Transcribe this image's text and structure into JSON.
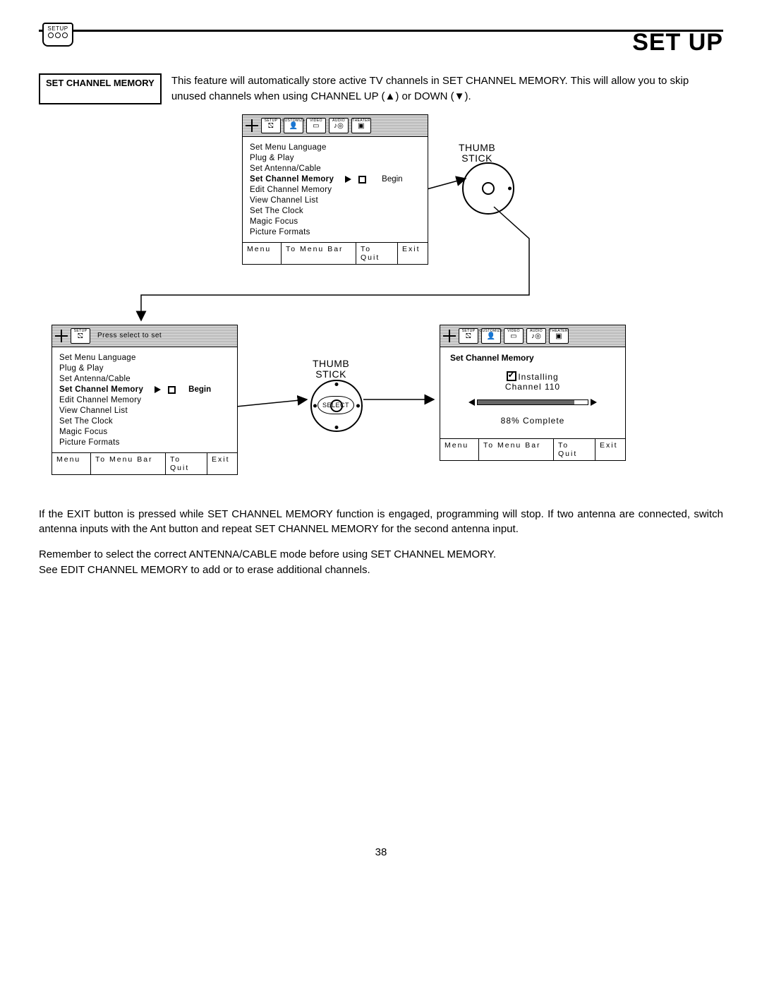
{
  "header": {
    "title": "SET UP",
    "badge_label": "SETUP"
  },
  "section_label": "SET CHANNEL MEMORY",
  "intro_text": "This feature will automatically store active TV channels in SET CHANNEL MEMORY.  This will allow you to skip unused channels when using CHANNEL UP (▲) or DOWN (▼).",
  "tabs": {
    "t0": "SETUP",
    "t1": "CUSTOMIZE",
    "t2": "VIDEO",
    "t3": "AUDIO",
    "t4": "THEATER"
  },
  "menu_items": {
    "m0": "Set Menu Language",
    "m1": "Plug & Play",
    "m2": "Set Antenna/Cable",
    "m3": "Set Channel Memory",
    "m4": "Edit Channel Memory",
    "m5": "View Channel List",
    "m6": "Set The Clock",
    "m7": "Magic Focus",
    "m8": "Picture Formats"
  },
  "begin_label": "Begin",
  "press_select": "Press select to set",
  "footer": {
    "menu": "Menu",
    "bar": "To Menu Bar",
    "quit": "To Quit",
    "exit": "Exit"
  },
  "thumb_label": "THUMB\nSTICK",
  "select_label": "SELECT",
  "installing": {
    "header": "Set Channel Memory",
    "line1": "Installing",
    "line2": "Channel 110",
    "progress": "88% Complete"
  },
  "para1": "If the EXIT button is pressed while SET CHANNEL MEMORY function is engaged, programming will stop.  If two antenna are connected, switch antenna inputs with the Ant button and repeat SET CHANNEL MEMORY for the second antenna input.",
  "para2a": "Remember to select the correct ANTENNA/CABLE mode before using SET CHANNEL MEMORY.",
  "para2b": "See EDIT CHANNEL MEMORY to add or to erase additional channels.",
  "page_number": "38"
}
